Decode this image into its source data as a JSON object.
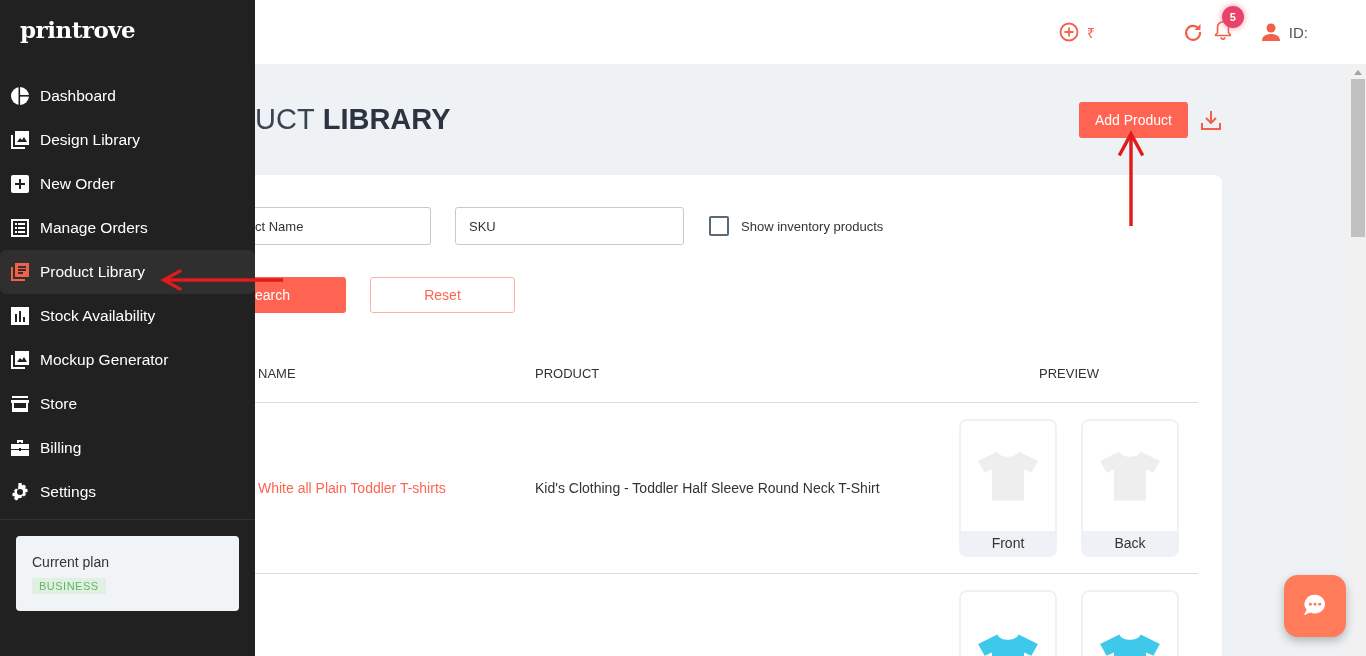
{
  "brand": "printrove",
  "sidebar": {
    "items": [
      {
        "label": "Dashboard",
        "kind": "pie",
        "selected": false
      },
      {
        "label": "Design Library",
        "kind": "images",
        "selected": false
      },
      {
        "label": "New Order",
        "kind": "plus",
        "selected": false
      },
      {
        "label": "Manage Orders",
        "kind": "list",
        "selected": false
      },
      {
        "label": "Product Library",
        "kind": "library",
        "selected": true
      },
      {
        "label": "Stock Availability",
        "kind": "chart",
        "selected": false
      },
      {
        "label": "Mockup Generator",
        "kind": "images",
        "selected": false
      },
      {
        "label": "Store",
        "kind": "store",
        "selected": false
      },
      {
        "label": "Billing",
        "kind": "briefcase",
        "selected": false
      },
      {
        "label": "Settings",
        "kind": "gear",
        "selected": false
      }
    ],
    "plan": {
      "label": "Current plan",
      "badge": "BUSINESS"
    }
  },
  "topbar": {
    "wallet": "₹",
    "notifications": "5",
    "user": "ID:"
  },
  "page": {
    "title_light": "UCT",
    "title_bold": "LIBRARY",
    "add_button": "Add Product"
  },
  "filters": {
    "name_placeholder": "ct Name",
    "sku_placeholder": "SKU",
    "inventory": {
      "label": "Show inventory products",
      "checked": false
    },
    "search_button": "earch",
    "reset_button": "Reset"
  },
  "table": {
    "columns": [
      "NAME",
      "PRODUCT",
      "PREVIEW"
    ],
    "rows": [
      {
        "name": "White all Plain Toddler T-shirts",
        "product": "Kid's Clothing - Toddler Half Sleeve Round Neck T-Shirt",
        "previews": [
          {
            "label": "Front",
            "color": "#eeeeee"
          },
          {
            "label": "Back",
            "color": "#eeeeee"
          }
        ]
      },
      {
        "previews": [
          {
            "color": "#3ec8ea"
          },
          {
            "color": "#3ec8ea"
          }
        ]
      }
    ]
  }
}
